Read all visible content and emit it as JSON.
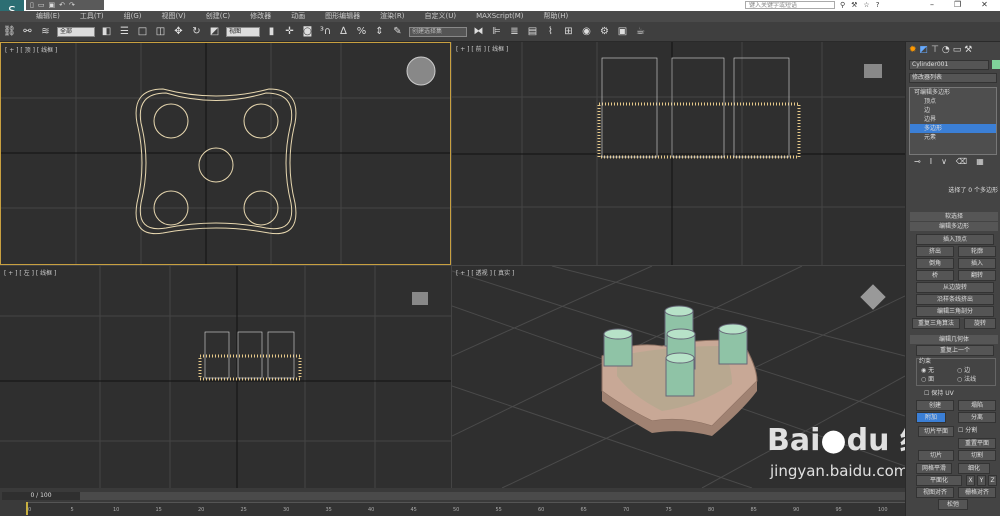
{
  "title": {
    "search_placeholder": "键入关键字或短语",
    "window_buttons": [
      "–",
      "❐",
      "✕"
    ]
  },
  "menu": [
    "编辑(E)",
    "工具(T)",
    "组(G)",
    "视图(V)",
    "创建(C)",
    "修改器",
    "动画",
    "图形编辑器",
    "渲染(R)",
    "自定义(U)",
    "MAXScript(M)",
    "帮助(H)"
  ],
  "toolbar": {
    "selection_filter": "全部",
    "reference_coord": "视图",
    "named_selection": "创建选择集"
  },
  "viewports": [
    {
      "label": "[ + ] [ 顶 ] [ 线框 ]"
    },
    {
      "label": "[ + ] [ 前 ] [ 线框 ]"
    },
    {
      "label": "[ + ] [ 左 ] [ 线框 ]"
    },
    {
      "label": "[ + ] [ 透视 ] [ 真实 ]"
    }
  ],
  "command_panel": {
    "object_name": "Cylinder001",
    "object_color": "#7fd39a",
    "modifier_list": "修改器列表",
    "stack": [
      "可编辑多边形",
      "顶点",
      "边",
      "边界",
      "多边形",
      "元素"
    ],
    "stack_selected": "多边形",
    "selection_status": "选择了 0 个多边形",
    "soft_selection": "软选择",
    "edit_poly_title": "编辑多边形",
    "edit_poly_buttons": [
      "插入顶点",
      "挤出",
      "轮廓",
      "倒角",
      "插入",
      "桥",
      "翻转",
      "从边旋转",
      "沿样条线挤出",
      "编辑三角剖分",
      "重复三角算法",
      "旋转"
    ],
    "edit_geom_title": "编辑几何体",
    "repeat_last": "重复上一个",
    "constraints_label": "约束",
    "constraints": [
      "无",
      "边",
      "面",
      "法线"
    ],
    "preserve_uv": "保持 UV",
    "geom_buttons": [
      "创建",
      "塌陷",
      "附加",
      "分离",
      "切片平面",
      "分割",
      "重置平面",
      "切片",
      "切割",
      "网格平滑",
      "细化",
      "平面化",
      "X",
      "Y",
      "Z",
      "视图对齐",
      "栅格对齐",
      "松弛"
    ]
  },
  "timeline": {
    "frame": "0 / 100",
    "ticks": [
      "0",
      "5",
      "10",
      "15",
      "20",
      "25",
      "30",
      "35",
      "40",
      "45",
      "50",
      "55",
      "60",
      "65",
      "70",
      "75",
      "80",
      "85",
      "90",
      "95",
      "100"
    ]
  },
  "watermark": {
    "brand": "Bai du 经验",
    "url": "jingyan.baidu.com"
  }
}
